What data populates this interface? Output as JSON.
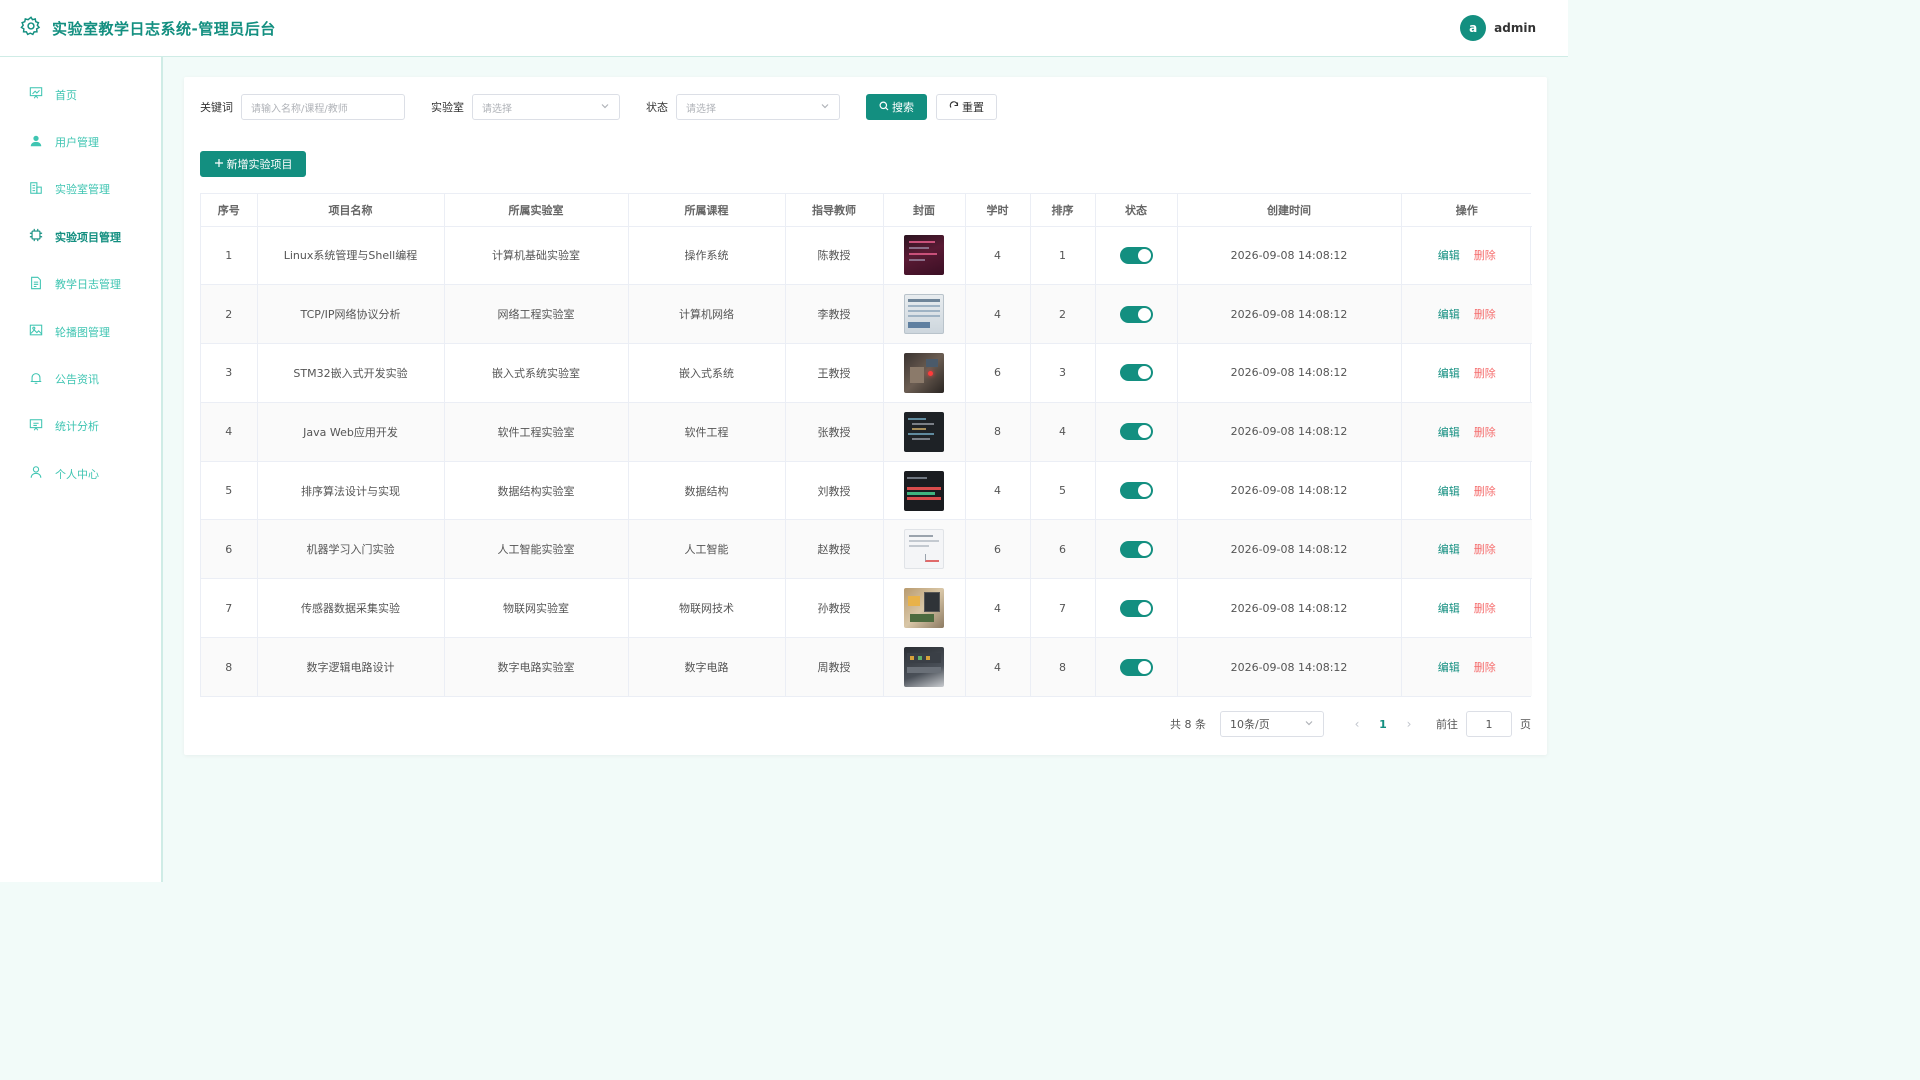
{
  "header": {
    "title": "实验室教学日志系统-管理员后台",
    "avatar_letter": "a",
    "username": "admin"
  },
  "sidebar": {
    "items": [
      {
        "label": "首页",
        "icon": "chart-board-icon",
        "active": false
      },
      {
        "label": "用户管理",
        "icon": "user-icon",
        "active": false
      },
      {
        "label": "实验室管理",
        "icon": "building-icon",
        "active": false
      },
      {
        "label": "实验项目管理",
        "icon": "cpu-chip-icon",
        "active": true
      },
      {
        "label": "教学日志管理",
        "icon": "document-icon",
        "active": false
      },
      {
        "label": "轮播图管理",
        "icon": "picture-icon",
        "active": false
      },
      {
        "label": "公告资讯",
        "icon": "bell-icon",
        "active": false
      },
      {
        "label": "统计分析",
        "icon": "data-board-icon",
        "active": false
      },
      {
        "label": "个人中心",
        "icon": "user-outline-icon",
        "active": false
      }
    ]
  },
  "filters": {
    "keyword_label": "关键词",
    "keyword_placeholder": "请输入名称/课程/教师",
    "lab_label": "实验室",
    "lab_placeholder": "请选择",
    "status_label": "状态",
    "status_placeholder": "请选择",
    "search_label": "搜索",
    "reset_label": "重置"
  },
  "add_button_label": "新增实验项目",
  "table": {
    "columns": [
      "序号",
      "项目名称",
      "所属实验室",
      "所属课程",
      "指导教师",
      "封面",
      "学时",
      "排序",
      "状态",
      "创建时间",
      "操作"
    ],
    "rows": [
      {
        "no": "1",
        "name": "Linux系统管理与Shell编程",
        "lab": "计算机基础实验室",
        "course": "操作系统",
        "teacher": "陈教授",
        "hours": "4",
        "order": "1",
        "status": true,
        "created": "2026-09-08 14:08:12"
      },
      {
        "no": "2",
        "name": "TCP/IP网络协议分析",
        "lab": "网络工程实验室",
        "course": "计算机网络",
        "teacher": "李教授",
        "hours": "4",
        "order": "2",
        "status": true,
        "created": "2026-09-08 14:08:12"
      },
      {
        "no": "3",
        "name": "STM32嵌入式开发实验",
        "lab": "嵌入式系统实验室",
        "course": "嵌入式系统",
        "teacher": "王教授",
        "hours": "6",
        "order": "3",
        "status": true,
        "created": "2026-09-08 14:08:12"
      },
      {
        "no": "4",
        "name": "Java Web应用开发",
        "lab": "软件工程实验室",
        "course": "软件工程",
        "teacher": "张教授",
        "hours": "8",
        "order": "4",
        "status": true,
        "created": "2026-09-08 14:08:12"
      },
      {
        "no": "5",
        "name": "排序算法设计与实现",
        "lab": "数据结构实验室",
        "course": "数据结构",
        "teacher": "刘教授",
        "hours": "4",
        "order": "5",
        "status": true,
        "created": "2026-09-08 14:08:12"
      },
      {
        "no": "6",
        "name": "机器学习入门实验",
        "lab": "人工智能实验室",
        "course": "人工智能",
        "teacher": "赵教授",
        "hours": "6",
        "order": "6",
        "status": true,
        "created": "2026-09-08 14:08:12"
      },
      {
        "no": "7",
        "name": "传感器数据采集实验",
        "lab": "物联网实验室",
        "course": "物联网技术",
        "teacher": "孙教授",
        "hours": "4",
        "order": "7",
        "status": true,
        "created": "2026-09-08 14:08:12"
      },
      {
        "no": "8",
        "name": "数字逻辑电路设计",
        "lab": "数字电路实验室",
        "course": "数字电路",
        "teacher": "周教授",
        "hours": "4",
        "order": "8",
        "status": true,
        "created": "2026-09-08 14:08:12"
      }
    ],
    "edit_label": "编辑",
    "delete_label": "删除"
  },
  "pagination": {
    "total_text": "共 8 条",
    "page_size": "10条/页",
    "current_page": "1",
    "goto_label": "前往",
    "goto_value": "1",
    "page_suffix": "页"
  },
  "colors": {
    "primary": "#138f80",
    "menu_text": "#3fc5b2",
    "danger": "#f56c6c",
    "background": "#f2fbf9"
  }
}
